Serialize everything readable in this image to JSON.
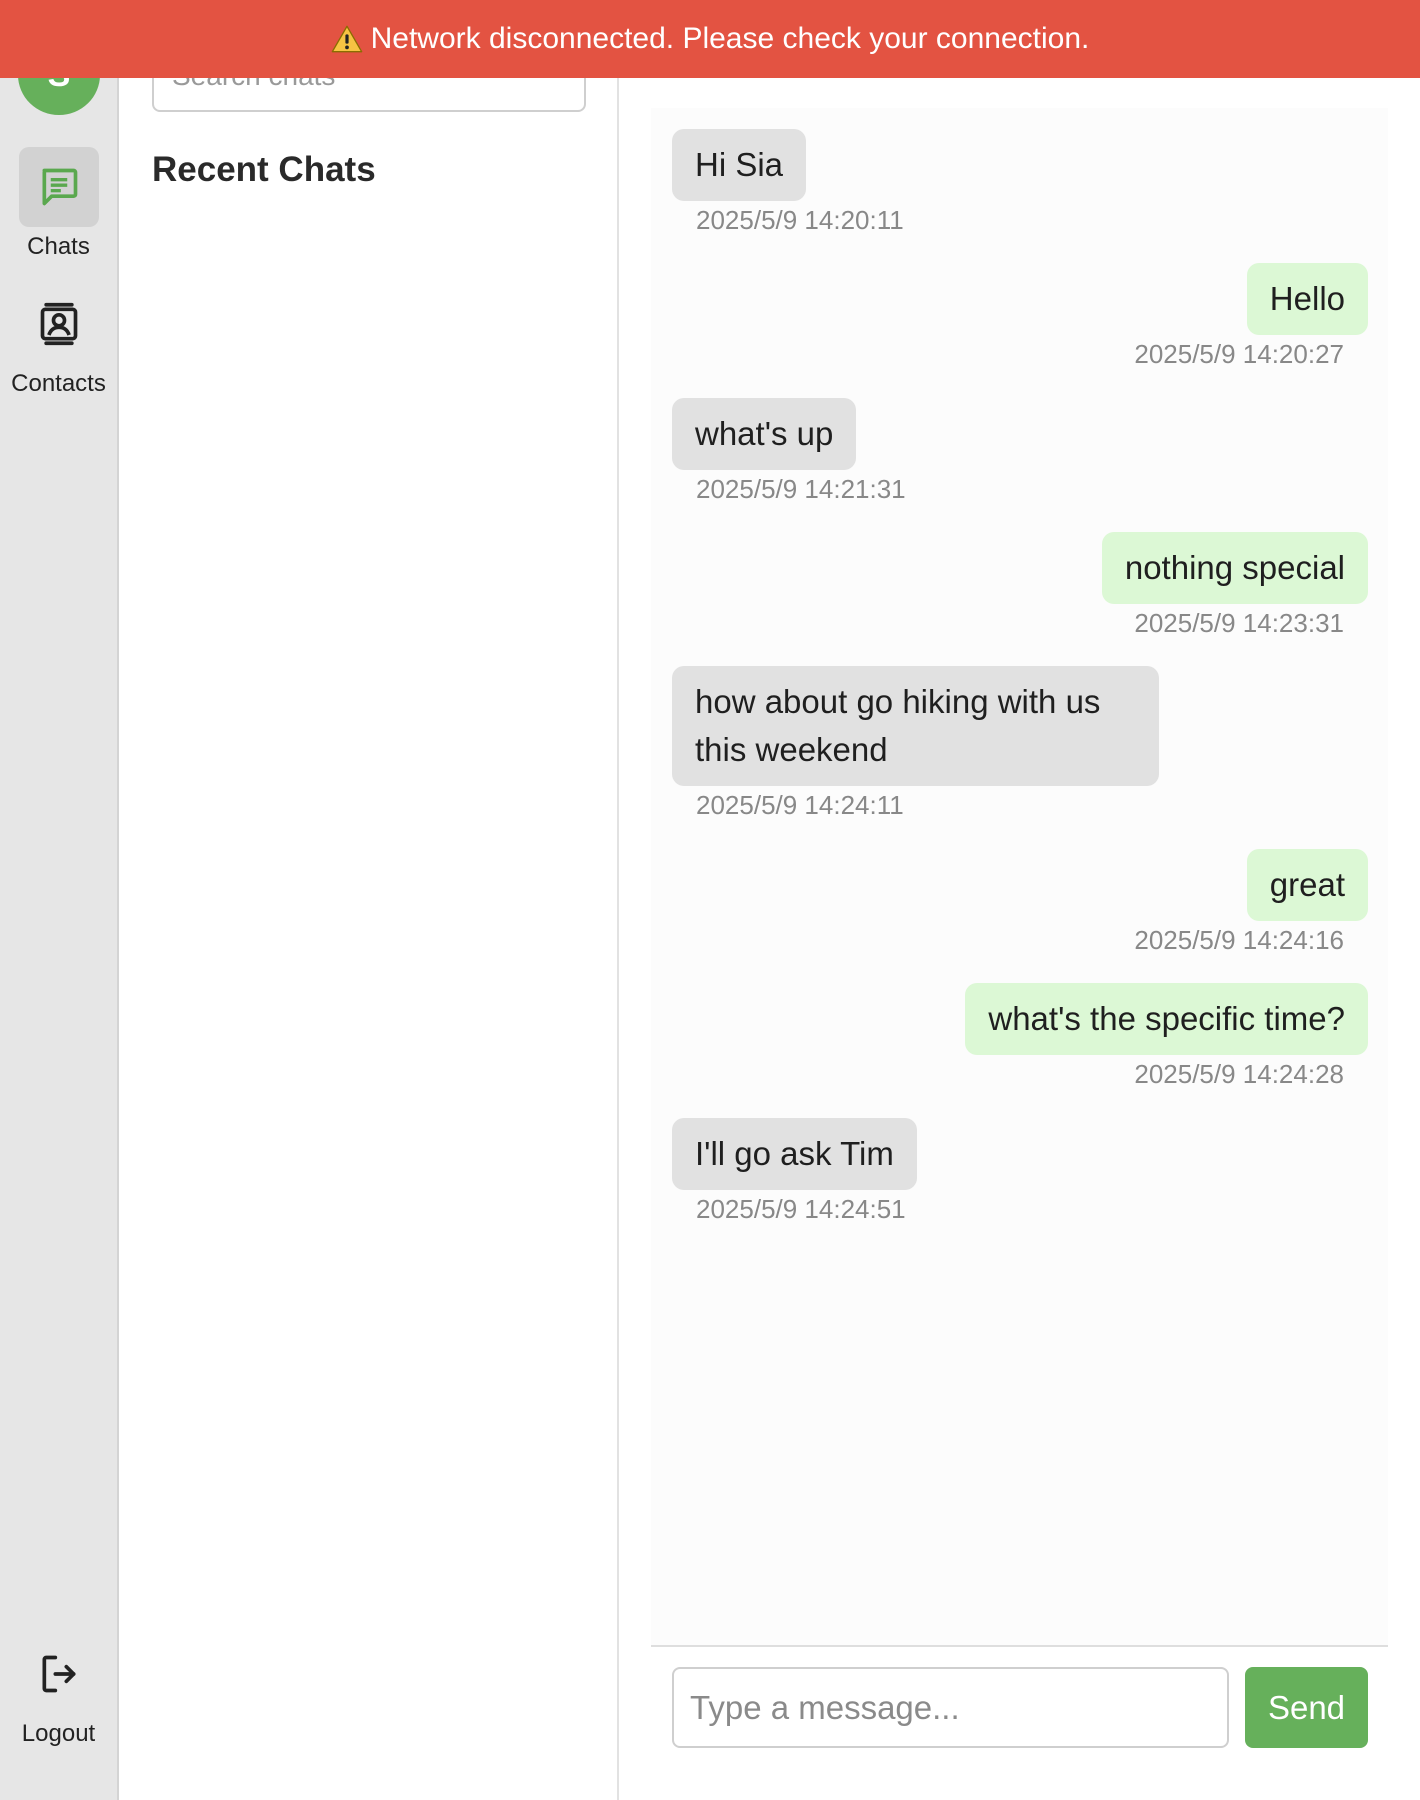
{
  "banner": {
    "icon": "warning-icon",
    "text": "Network disconnected. Please check your connection."
  },
  "nav": {
    "avatar_letter": "S",
    "items": [
      {
        "label": "Chats",
        "icon": "chat-icon",
        "active": true
      },
      {
        "label": "Contacts",
        "icon": "contacts-icon",
        "active": false
      }
    ],
    "logout": {
      "label": "Logout",
      "icon": "logout-icon"
    }
  },
  "list": {
    "search_placeholder": "Search chats",
    "heading": "Recent Chats"
  },
  "messages": [
    {
      "dir": "in",
      "text": "Hi Sia",
      "time": "2025/5/9 14:20:11"
    },
    {
      "dir": "out",
      "text": "Hello",
      "time": "2025/5/9 14:20:27"
    },
    {
      "dir": "in",
      "text": "what's up",
      "time": "2025/5/9 14:21:31"
    },
    {
      "dir": "out",
      "text": "nothing special",
      "time": "2025/5/9 14:23:31"
    },
    {
      "dir": "in",
      "text": "how about go hiking with us this weekend",
      "time": "2025/5/9 14:24:11"
    },
    {
      "dir": "out",
      "text": "great",
      "time": "2025/5/9 14:24:16"
    },
    {
      "dir": "out",
      "text": "what's the specific time?",
      "time": "2025/5/9 14:24:28"
    },
    {
      "dir": "in",
      "text": "I'll go ask Tim",
      "time": "2025/5/9 14:24:51"
    }
  ],
  "composer": {
    "placeholder": "Type a message...",
    "send_label": "Send"
  },
  "colors": {
    "accent": "#66b05b",
    "banner": "#e35342",
    "incoming_bubble": "#e1e1e1",
    "outgoing_bubble": "#dcf8d5"
  }
}
